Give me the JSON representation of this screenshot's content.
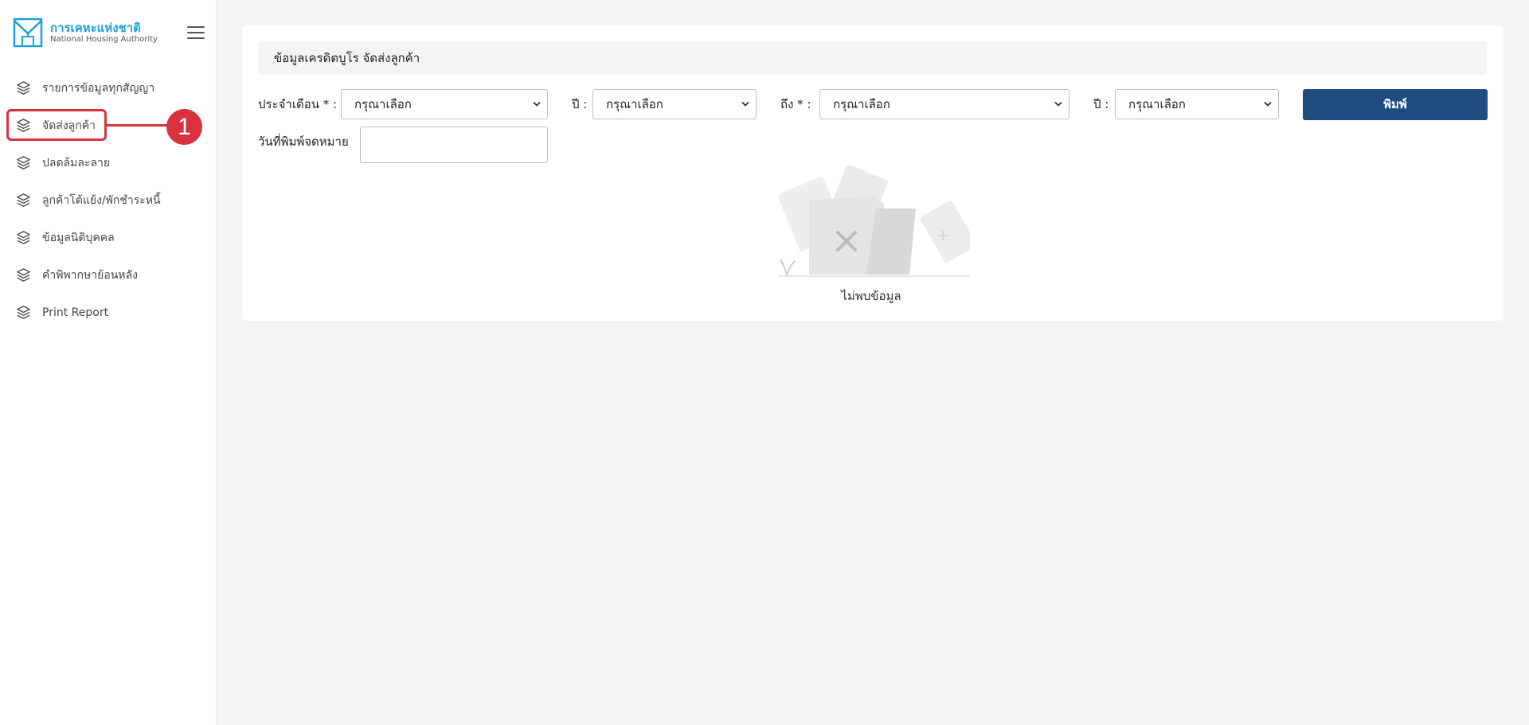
{
  "app": {
    "logo": {
      "name_th": "การเคหะแห่งชาติ",
      "name_en": "National Housing Authority",
      "icon": "nha-logo-icon"
    },
    "menu_toggle_icon": "hamburger-menu-icon"
  },
  "sidebar": {
    "items": [
      {
        "label": "รายการข้อมูลทุกสัญญา",
        "icon": "layers-icon"
      },
      {
        "label": "จัดส่งลูกค้า",
        "icon": "layers-icon",
        "highlighted": true
      },
      {
        "label": "ปลดล้มละลาย",
        "icon": "layers-icon"
      },
      {
        "label": "ลูกค้าโต้แย้ง/พักชำระหนี้",
        "icon": "layers-icon"
      },
      {
        "label": "ข้อมูลนิติบุคคล",
        "icon": "layers-icon"
      },
      {
        "label": "คำพิพากษาย้อนหลัง",
        "icon": "layers-icon"
      },
      {
        "label": "Print Report",
        "icon": "layers-icon"
      }
    ]
  },
  "annotation": {
    "badge": "1",
    "color": "#d9323f"
  },
  "main": {
    "header_title": "ข้อมูลเครดิตบูโร จัดส่งลูกค้า",
    "filters": {
      "month_from_label": "ประจำเดือน * :",
      "month_from_value": "กรุณาเลือก",
      "year_from_label": "ปี :",
      "year_from_value": "กรุณาเลือก",
      "month_to_label": "ถึง * :",
      "month_to_value": "กรุณาเลือก",
      "year_to_label": "ปี :",
      "year_to_value": "กรุณาเลือก",
      "print_date_label": "วันที่พิมพ์จดหมาย",
      "print_date_value": ""
    },
    "print_button": "พิมพ์",
    "empty_state": {
      "text": "ไม่พบข้อมูล",
      "icon": "empty-folder-icon"
    }
  },
  "colors": {
    "accent": "#1ba1dc",
    "primary_button": "#1f4b80",
    "annotation": "#d9323f",
    "background": "#f4f4f4"
  }
}
